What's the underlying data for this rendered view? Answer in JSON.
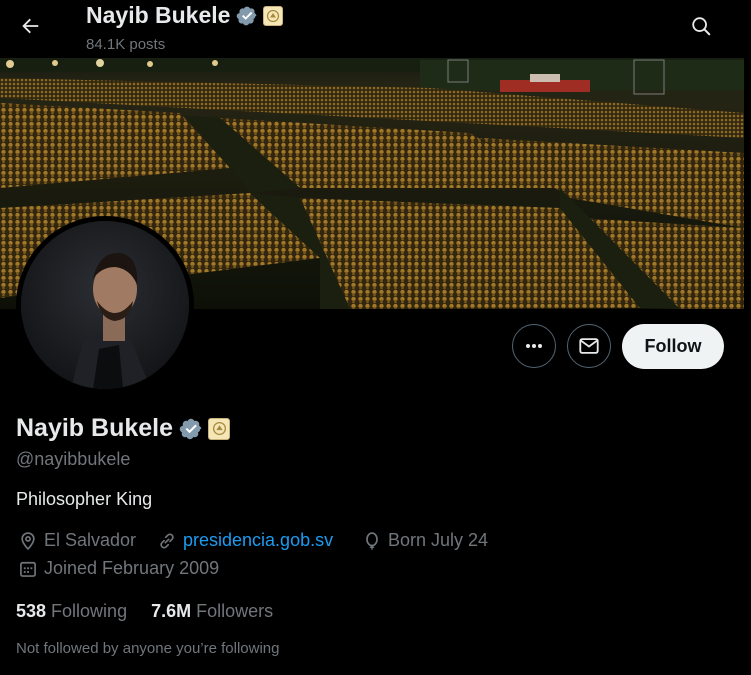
{
  "header": {
    "title": "Nayib Bukele",
    "posts": "84.1K posts"
  },
  "profile": {
    "name": "Nayib Bukele",
    "handle": "@nayibbukele",
    "bio": "Philosopher King",
    "location": "El Salvador",
    "website": "presidencia.gob.sv",
    "birthday": "Born July 24",
    "joined": "Joined February 2009"
  },
  "stats": {
    "following_count": "538",
    "following_label": "Following",
    "followers_count": "7.6M",
    "followers_label": "Followers"
  },
  "follow_button": "Follow",
  "not_followed": "Not followed by anyone you’re following",
  "colors": {
    "accent": "#1d9bf0",
    "verified": "#829aab",
    "muted_text": "#71767b"
  },
  "icons": [
    "back-arrow-icon",
    "search-icon",
    "verified-badge-icon",
    "affiliate-badge-icon",
    "more-icon",
    "message-icon",
    "location-icon",
    "link-icon",
    "balloon-icon",
    "calendar-icon"
  ]
}
